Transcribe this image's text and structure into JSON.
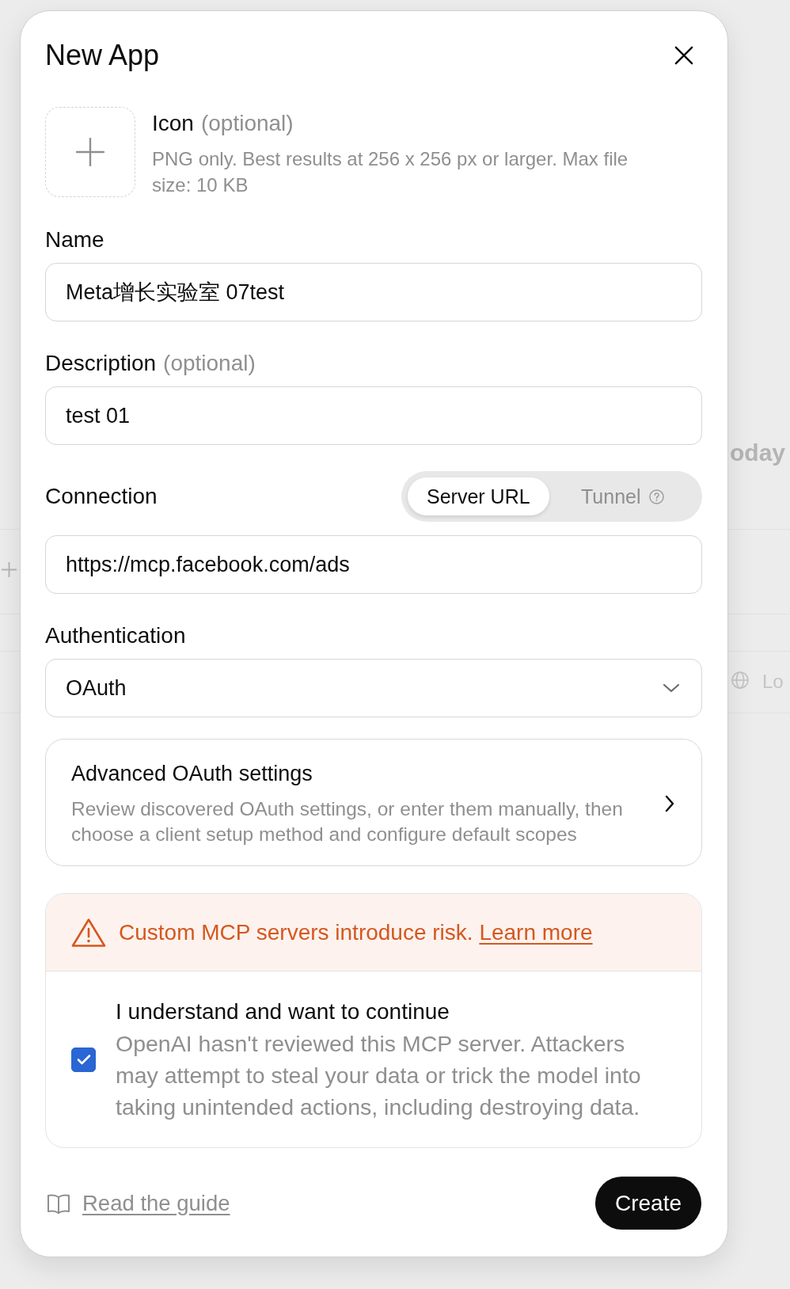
{
  "dialog": {
    "title": "New App"
  },
  "icon_upload": {
    "label": "Icon",
    "optional": "(optional)",
    "help": "PNG only. Best results at 256 x 256 px or larger. Max file size: 10 KB"
  },
  "fields": [
    {
      "label": "Name",
      "value": "Meta增长实验室 07test"
    },
    {
      "label": "Description",
      "optional": "(optional)",
      "value": "test 01"
    }
  ],
  "connection": {
    "label": "Connection",
    "modes": [
      {
        "label": "Server URL",
        "selected": true,
        "help_icon": false
      },
      {
        "label": "Tunnel",
        "selected": false,
        "help_icon": true
      }
    ],
    "value": "https://mcp.facebook.com/ads"
  },
  "authentication": {
    "label": "Authentication",
    "value": "OAuth"
  },
  "advanced_settings": {
    "title": "Advanced OAuth settings",
    "description": "Review discovered OAuth settings, or enter them manually, then choose a client setup method and configure default scopes"
  },
  "warning": {
    "text": "Custom MCP servers introduce risk.",
    "link": "Learn more"
  },
  "acknowledge": {
    "checked": true,
    "title": "I understand and want to continue",
    "description": "OpenAI hasn't reviewed this MCP server. Attackers may attempt to steal your data or trick the model into taking unintended actions, including destroying data."
  },
  "footer": {
    "guide_link": "Read the guide",
    "create_button": "Create"
  },
  "background": {
    "heading": "oday",
    "item": "Lo"
  }
}
